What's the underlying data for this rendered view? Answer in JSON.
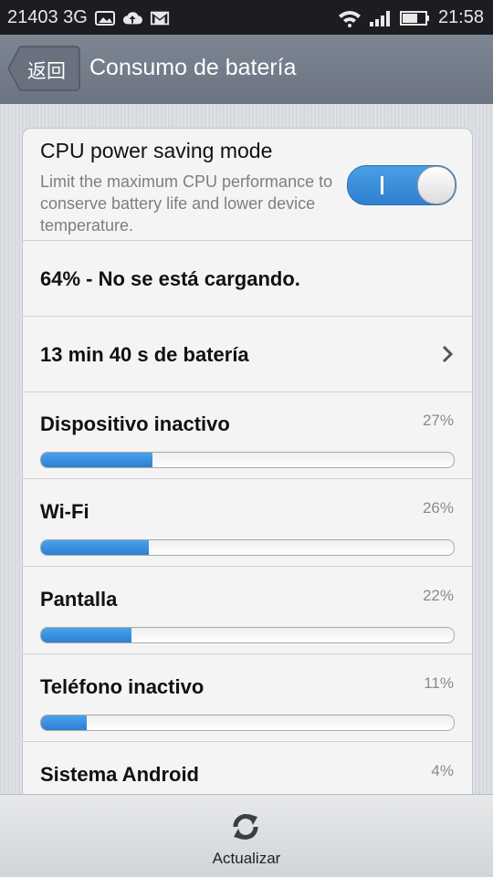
{
  "status_bar": {
    "carrier": "21403 3G",
    "time": "21:58",
    "icons": [
      "image-icon",
      "cloud-upload-icon",
      "gmail-icon",
      "wifi-icon",
      "signal-icon",
      "battery-icon"
    ]
  },
  "title_bar": {
    "back_label": "返回",
    "title": "Consumo de batería"
  },
  "cpu_saving": {
    "title": "CPU power saving mode",
    "description": "Limit the maximum CPU performance to conserve battery life and lower device temperature.",
    "enabled": true
  },
  "battery_status": "64% - No se está cargando.",
  "battery_time": "13 min 40 s de batería",
  "usage": [
    {
      "name": "Dispositivo inactivo",
      "percent": "27%",
      "fill": 0.27
    },
    {
      "name": "Wi-Fi",
      "percent": "26%",
      "fill": 0.26
    },
    {
      "name": "Pantalla",
      "percent": "22%",
      "fill": 0.22
    },
    {
      "name": "Teléfono inactivo",
      "percent": "11%",
      "fill": 0.11
    },
    {
      "name": "Sistema Android",
      "percent": "4%",
      "fill": 0.04
    }
  ],
  "bottom_bar": {
    "refresh_label": "Actualizar"
  },
  "colors": {
    "accent": "#2f7fd0",
    "title_bar": "#737c88",
    "status_bar": "#1b1d21"
  }
}
